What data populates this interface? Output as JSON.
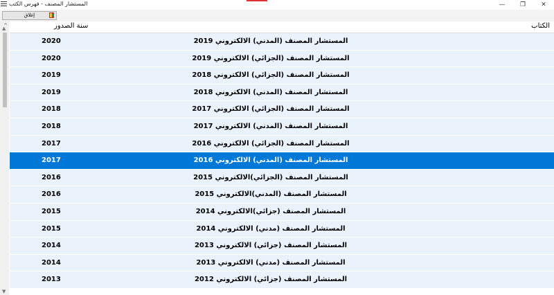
{
  "window": {
    "title": "المستشار المصنف - فهرس الكتب",
    "minimize_glyph": "—",
    "restore_glyph": "❐",
    "close_glyph": "✕"
  },
  "toolbar": {
    "close_label": "إغلاق"
  },
  "grid": {
    "columns": {
      "book": "الكتاب",
      "year": "سنة الصدور"
    },
    "rows": [
      {
        "book": "المستشار المصنف (المدني) الالكتروني 2019",
        "year": "2020"
      },
      {
        "book": "المستشار المصنف (الجزائي) الالكتروني 2019",
        "year": "2020"
      },
      {
        "book": "المستشار المصنف (الجزائي) الالكتروني 2018",
        "year": "2019"
      },
      {
        "book": "المستشار المصنف (المدني) الالكتروني 2018",
        "year": "2019"
      },
      {
        "book": "المستشار المصنف (الجزائي) الالكتروني 2017",
        "year": "2018"
      },
      {
        "book": "المستشار المصنف (المدني) الالكتروني 2017",
        "year": "2018"
      },
      {
        "book": "المستشار المصنف (الجزائي) الالكتروني 2016",
        "year": "2017"
      },
      {
        "book": "المستشار المصنف (المدني) الالكتروني 2016",
        "year": "2017",
        "selected": true
      },
      {
        "book": "المستشار المصنف (الجزائي)الالكتروني 2015",
        "year": "2016"
      },
      {
        "book": "المستشار المصنف (المدني)الالكتروني 2015",
        "year": "2016"
      },
      {
        "book": "المستشار المصنف (جزائي)الالكتروني 2014",
        "year": "2015"
      },
      {
        "book": "المستشار المصنف (مدني) الالكتروني 2014",
        "year": "2015"
      },
      {
        "book": "المستشار المصنف (جزائي) الالكتروني 2013",
        "year": "2014"
      },
      {
        "book": "المستشار المصنف (مدني) الالكتروني 2013",
        "year": "2014"
      },
      {
        "book": "المستشار المصنف (جزائي) الالكتروني 2012",
        "year": "2013"
      }
    ]
  },
  "colors": {
    "selected_row": "#0078d7",
    "row_bg": "#eaf2fb"
  }
}
